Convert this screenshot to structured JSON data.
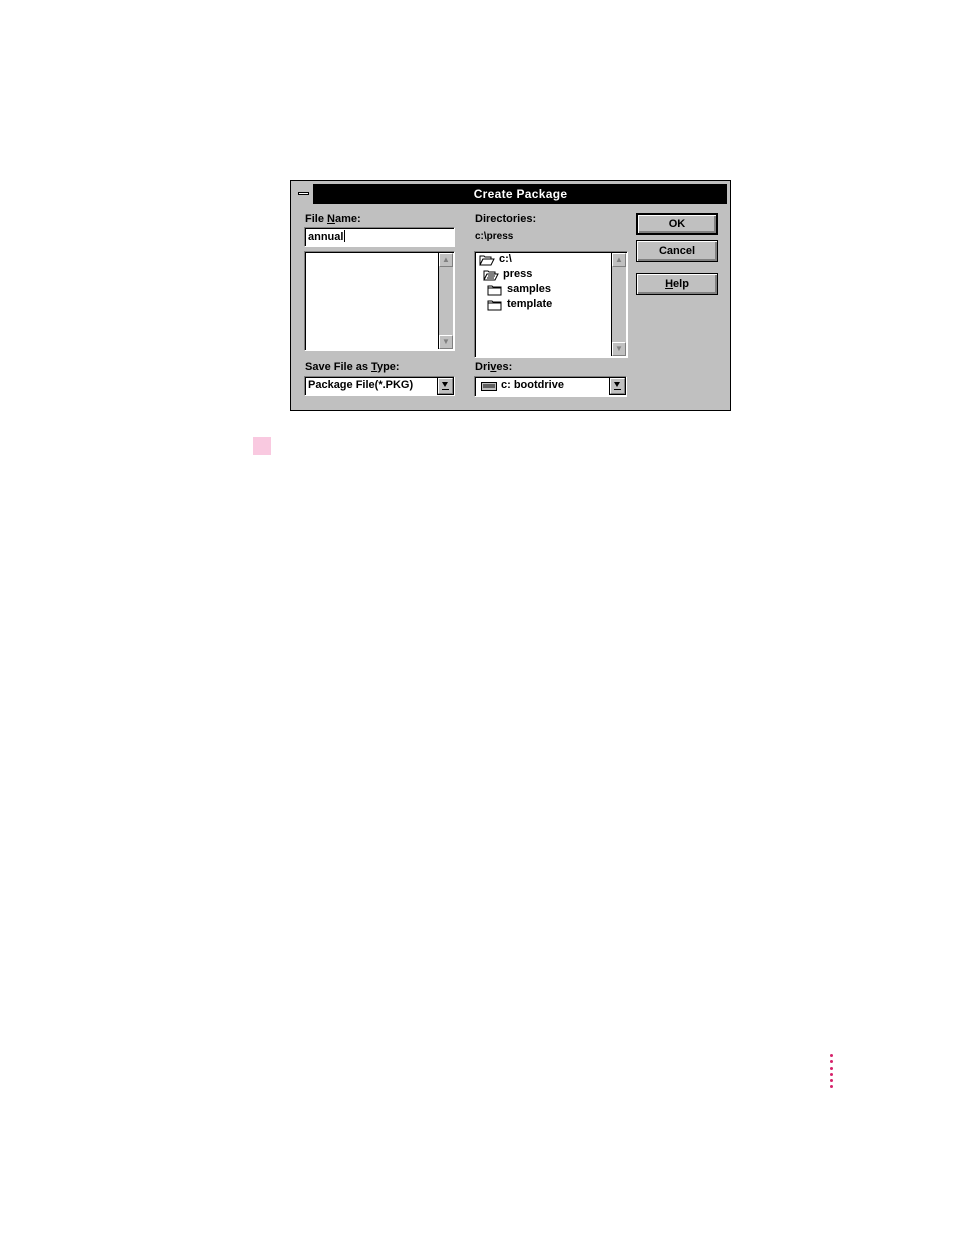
{
  "dialog": {
    "title": "Create Package",
    "file_name": {
      "label_prefix": "File ",
      "label_accel": "N",
      "label_suffix": "ame:",
      "value": "annual"
    },
    "file_list": {
      "items": []
    },
    "save_type": {
      "label_prefix": "Save File as ",
      "label_accel": "T",
      "label_suffix": "ype:",
      "value": "Package File(*.PKG)"
    },
    "directories": {
      "label": "Directories:",
      "current_path": "c:\\press",
      "items": [
        {
          "name": "c:\\",
          "icon": "open-folder-icon"
        },
        {
          "name": "press",
          "icon": "open-folder-icon"
        },
        {
          "name": "samples",
          "icon": "folder-icon"
        },
        {
          "name": "template",
          "icon": "folder-icon"
        }
      ]
    },
    "drives": {
      "label_prefix": "Dri",
      "label_accel": "v",
      "label_suffix": "es:",
      "value": "c: bootdrive",
      "icon": "drive-icon"
    },
    "buttons": {
      "ok": "OK",
      "cancel": "Cancel",
      "help_accel": "H",
      "help_suffix": "elp"
    }
  },
  "colors": {
    "accent_marker": "#f9c9e0",
    "dots": "#d6246b",
    "dialog_bg": "#c0c0c0",
    "titlebar_bg": "#000000"
  }
}
